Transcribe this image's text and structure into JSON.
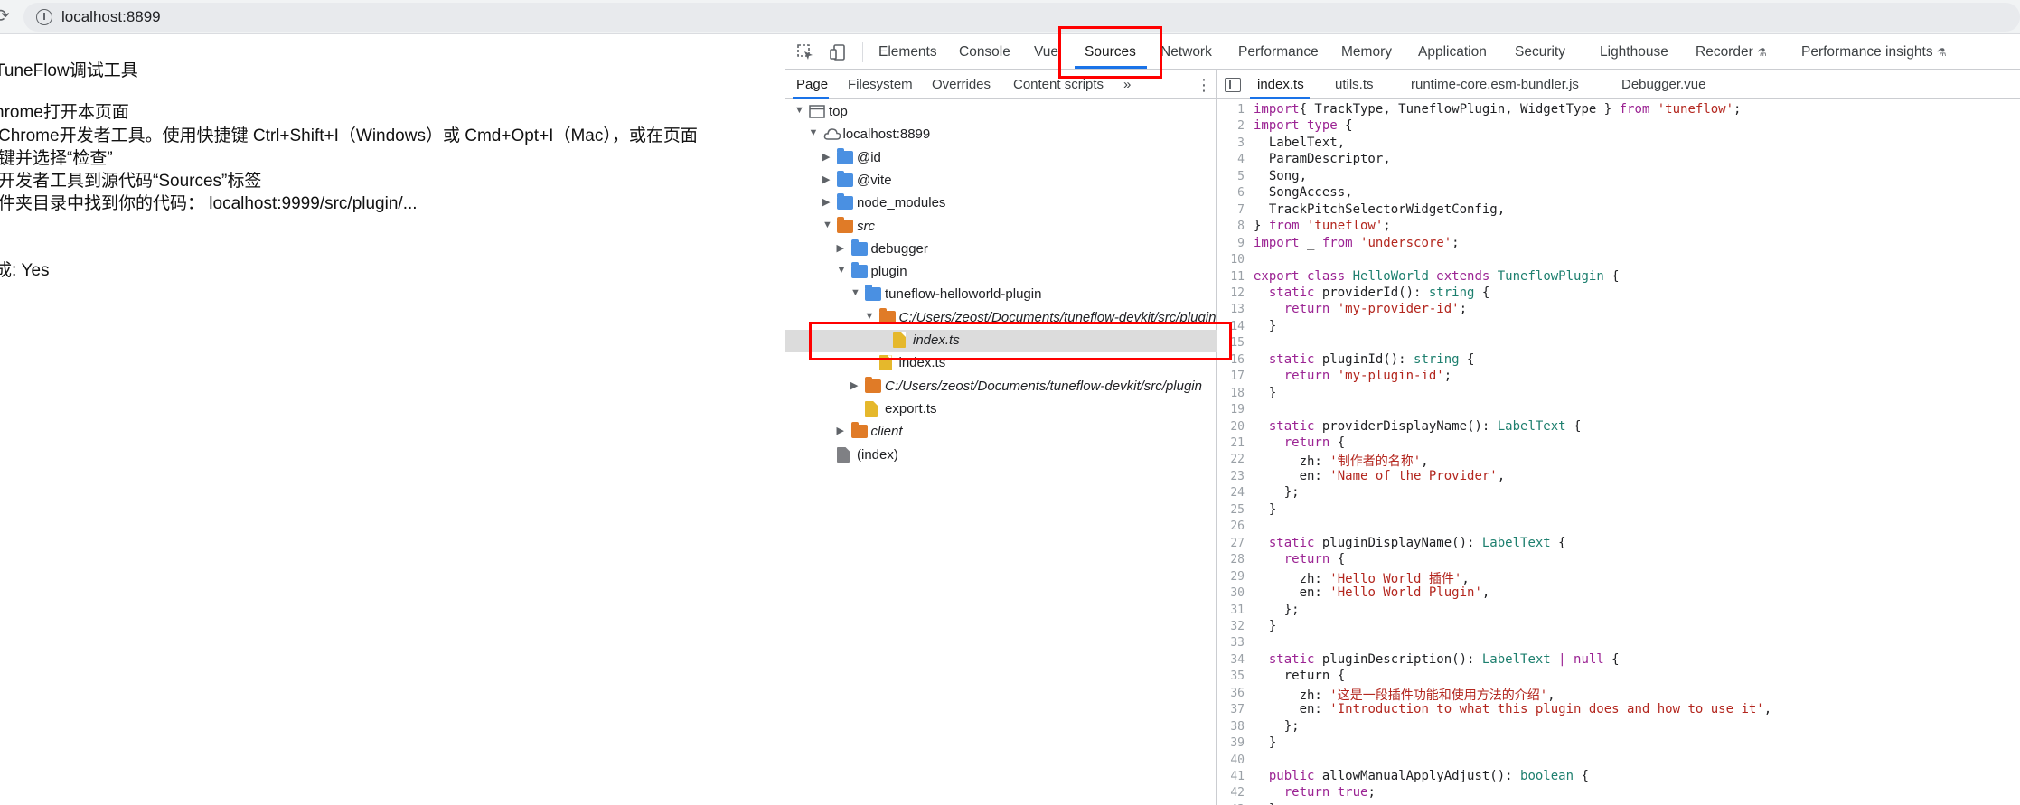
{
  "browser": {
    "url": "localhost:8899",
    "reload_icon": "reload-icon",
    "info_icon": "info-icon"
  },
  "page": {
    "lines": [
      "TuneFlow调试工具",
      "hrome打开本页面",
      "Chrome开发者工具。使用快捷键 Ctrl+Shift+I（Windows）或 Cmd+Opt+I（Mac），或在页面",
      "键并选择“检查”",
      "开发者工具到源代码“Sources”标签",
      "件夹目录中找到你的代码： localhost:9999/src/plugin/...",
      "成: Yes"
    ]
  },
  "devtools": {
    "tabs": [
      "Elements",
      "Console",
      "Vue",
      "Sources",
      "Network",
      "Performance",
      "Memory",
      "Application",
      "Security",
      "Lighthouse",
      "Recorder",
      "Performance insights"
    ],
    "active_tab": "Sources",
    "navigator": {
      "tabs": [
        "Page",
        "Filesystem",
        "Overrides",
        "Content scripts"
      ],
      "more": "»",
      "tree": [
        {
          "label": "top",
          "depth": 0,
          "icon": "window",
          "arrow": "down"
        },
        {
          "label": "localhost:8899",
          "depth": 1,
          "icon": "cloud",
          "arrow": "down"
        },
        {
          "label": "@id",
          "depth": 2,
          "icon": "folder-blue",
          "arrow": "right"
        },
        {
          "label": "@vite",
          "depth": 2,
          "icon": "folder-blue",
          "arrow": "right"
        },
        {
          "label": "node_modules",
          "depth": 2,
          "icon": "folder-blue",
          "arrow": "right"
        },
        {
          "label": "src",
          "depth": 2,
          "icon": "folder-orange",
          "arrow": "down",
          "italic": true
        },
        {
          "label": "debugger",
          "depth": 3,
          "icon": "folder-blue",
          "arrow": "right"
        },
        {
          "label": "plugin",
          "depth": 3,
          "icon": "folder-blue",
          "arrow": "down"
        },
        {
          "label": "tuneflow-helloworld-plugin",
          "depth": 4,
          "icon": "folder-blue",
          "arrow": "down"
        },
        {
          "label": "C:/Users/zeost/Documents/tuneflow-devkit/src/plugin",
          "depth": 5,
          "icon": "folder-orange",
          "arrow": "down",
          "italic": true
        },
        {
          "label": "index.ts",
          "depth": 6,
          "icon": "file-yellow",
          "arrow": "",
          "italic": true,
          "selected": true
        },
        {
          "label": "index.ts",
          "depth": 5,
          "icon": "file-yellow",
          "arrow": ""
        },
        {
          "label": "C:/Users/zeost/Documents/tuneflow-devkit/src/plugin",
          "depth": 4,
          "icon": "folder-orange",
          "arrow": "right",
          "italic": true
        },
        {
          "label": "export.ts",
          "depth": 4,
          "icon": "file-yellow",
          "arrow": ""
        },
        {
          "label": "client",
          "depth": 3,
          "icon": "folder-orange",
          "arrow": "right",
          "italic": true
        },
        {
          "label": "(index)",
          "depth": 2,
          "icon": "file-gray",
          "arrow": ""
        }
      ]
    },
    "editor": {
      "tabs": [
        "index.ts",
        "utils.ts",
        "runtime-core.esm-bundler.js",
        "Debugger.vue"
      ],
      "active_tab": "index.ts",
      "code": [
        [
          [
            "kw",
            "import"
          ],
          [
            "",
            "{ TrackType, TuneflowPlugin, WidgetType } "
          ],
          [
            "kw",
            "from"
          ],
          [
            "st",
            " 'tuneflow'"
          ],
          [
            "",
            ";"
          ]
        ],
        [
          [
            "kw",
            "import type"
          ],
          [
            "",
            " {"
          ]
        ],
        [
          [
            "",
            "  LabelText,"
          ]
        ],
        [
          [
            "",
            "  ParamDescriptor,"
          ]
        ],
        [
          [
            "",
            "  Song,"
          ]
        ],
        [
          [
            "",
            "  SongAccess,"
          ]
        ],
        [
          [
            "",
            "  TrackPitchSelectorWidgetConfig,"
          ]
        ],
        [
          [
            "",
            "} "
          ],
          [
            "kw",
            "from"
          ],
          [
            "st",
            " 'tuneflow'"
          ],
          [
            "",
            ";"
          ]
        ],
        [
          [
            "kw",
            "import"
          ],
          [
            "",
            " _ "
          ],
          [
            "kw",
            "from"
          ],
          [
            "st",
            " 'underscore'"
          ],
          [
            "",
            ";"
          ]
        ],
        [
          [
            "",
            ""
          ]
        ],
        [
          [
            "kw",
            "export class"
          ],
          [
            "ty",
            " HelloWorld"
          ],
          [
            "kw",
            " extends"
          ],
          [
            "ty",
            " TuneflowPlugin"
          ],
          [
            "",
            " {"
          ]
        ],
        [
          [
            "",
            "  "
          ],
          [
            "kw",
            "static"
          ],
          [
            "",
            " providerId(): "
          ],
          [
            "ty",
            "string"
          ],
          [
            "",
            " {"
          ]
        ],
        [
          [
            "",
            "    "
          ],
          [
            "kw",
            "return"
          ],
          [
            "st",
            " 'my-provider-id'"
          ],
          [
            "",
            ";"
          ]
        ],
        [
          [
            "",
            "  }"
          ]
        ],
        [
          [
            "",
            ""
          ]
        ],
        [
          [
            "",
            "  "
          ],
          [
            "kw",
            "static"
          ],
          [
            "",
            " pluginId(): "
          ],
          [
            "ty",
            "string"
          ],
          [
            "",
            " {"
          ]
        ],
        [
          [
            "",
            "    "
          ],
          [
            "kw",
            "return"
          ],
          [
            "st",
            " 'my-plugin-id'"
          ],
          [
            "",
            ";"
          ]
        ],
        [
          [
            "",
            "  }"
          ]
        ],
        [
          [
            "",
            ""
          ]
        ],
        [
          [
            "",
            "  "
          ],
          [
            "kw",
            "static"
          ],
          [
            "",
            " providerDisplayName(): "
          ],
          [
            "ty",
            "LabelText"
          ],
          [
            "",
            " {"
          ]
        ],
        [
          [
            "",
            "    "
          ],
          [
            "kw",
            "return"
          ],
          [
            "",
            " {"
          ]
        ],
        [
          [
            "",
            "      zh: "
          ],
          [
            "st",
            "'制作者的名称'"
          ],
          [
            "",
            ","
          ]
        ],
        [
          [
            "",
            "      en: "
          ],
          [
            "st",
            "'Name of the Provider'"
          ],
          [
            "",
            ","
          ]
        ],
        [
          [
            "",
            "    };"
          ]
        ],
        [
          [
            "",
            "  }"
          ]
        ],
        [
          [
            "",
            ""
          ]
        ],
        [
          [
            "",
            "  "
          ],
          [
            "kw",
            "static"
          ],
          [
            "",
            " pluginDisplayName(): "
          ],
          [
            "ty",
            "LabelText"
          ],
          [
            "",
            " {"
          ]
        ],
        [
          [
            "",
            "    "
          ],
          [
            "kw",
            "return"
          ],
          [
            "",
            " {"
          ]
        ],
        [
          [
            "",
            "      zh: "
          ],
          [
            "st",
            "'Hello World 插件'"
          ],
          [
            "",
            ","
          ]
        ],
        [
          [
            "",
            "      en: "
          ],
          [
            "st",
            "'Hello World Plugin'"
          ],
          [
            "",
            ","
          ]
        ],
        [
          [
            "",
            "    };"
          ]
        ],
        [
          [
            "",
            "  }"
          ]
        ],
        [
          [
            "",
            ""
          ]
        ],
        [
          [
            "",
            "  "
          ],
          [
            "kw",
            "static"
          ],
          [
            "",
            " pluginDescription(): "
          ],
          [
            "ty",
            "LabelText"
          ],
          [
            "kw",
            " |"
          ],
          [
            "kw",
            " null"
          ],
          [
            "",
            " {"
          ]
        ],
        [
          [
            "",
            "    return {"
          ]
        ],
        [
          [
            "",
            "      zh: "
          ],
          [
            "st",
            "'这是一段插件功能和使用方法的介绍'"
          ],
          [
            "",
            ","
          ]
        ],
        [
          [
            "",
            "      en: "
          ],
          [
            "st",
            "'Introduction to what this plugin does and how to use it'"
          ],
          [
            "",
            ","
          ]
        ],
        [
          [
            "",
            "    };"
          ]
        ],
        [
          [
            "",
            "  }"
          ]
        ],
        [
          [
            "",
            ""
          ]
        ],
        [
          [
            "",
            "  "
          ],
          [
            "kw",
            "public"
          ],
          [
            "",
            " allowManualApplyAdjust(): "
          ],
          [
            "ty",
            "boolean"
          ],
          [
            "",
            " {"
          ]
        ],
        [
          [
            "",
            "    "
          ],
          [
            "kw",
            "return"
          ],
          [
            "kw",
            " true"
          ],
          [
            "",
            ";"
          ]
        ],
        [
          [
            "",
            "  }"
          ]
        ]
      ]
    }
  },
  "colors": {
    "highlight": "#ff0000",
    "accent": "#1a73e8"
  }
}
